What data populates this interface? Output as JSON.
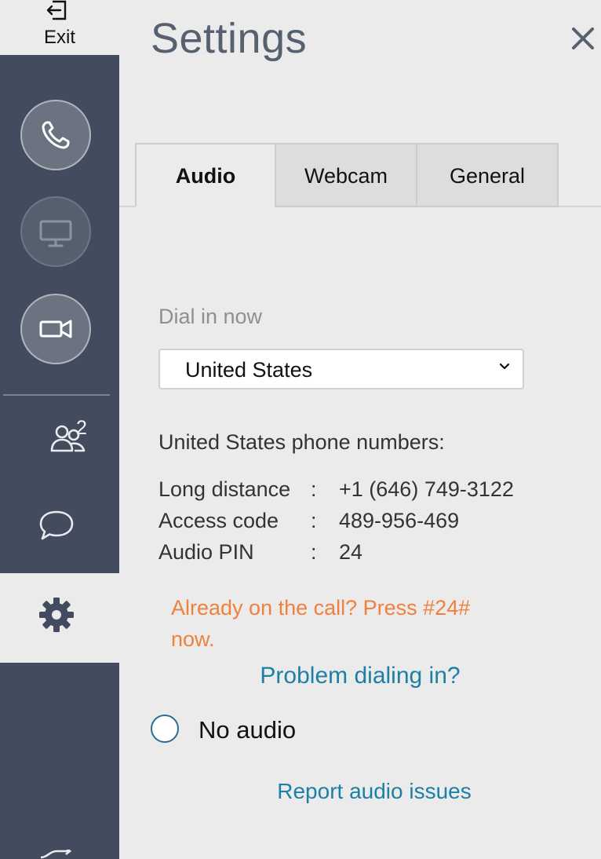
{
  "sidebar": {
    "exit_label": "Exit",
    "participant_count": "2",
    "buttons": [
      {
        "name": "phone",
        "state": "on"
      },
      {
        "name": "screen-share",
        "state": "off"
      },
      {
        "name": "video",
        "state": "on"
      }
    ],
    "icons": [
      "exit-icon",
      "phone-icon",
      "monitor-icon",
      "video-camera-icon",
      "people-icon",
      "chat-bubble-icon",
      "gear-icon",
      "shuffle-icon"
    ]
  },
  "header": {
    "title": "Settings",
    "close_icon": "close-icon"
  },
  "tabs": [
    {
      "label": "Audio",
      "active": true
    },
    {
      "label": "Webcam",
      "active": false
    },
    {
      "label": "General",
      "active": false
    }
  ],
  "audio": {
    "dial_label": "Dial in now",
    "country_select": {
      "value": "United States"
    },
    "phones_heading": "United States phone numbers:",
    "numbers": [
      {
        "label": "Long distance",
        "sep": ":",
        "value": "+1 (646) 749-3122"
      },
      {
        "label": "Access code",
        "sep": ":",
        "value": "489-956-469"
      },
      {
        "label": "Audio PIN",
        "sep": ":",
        "value": "24"
      }
    ],
    "already_on_call": "Already on the call? Press #24# now.",
    "problem_link": "Problem dialing in?",
    "no_audio_label": "No audio",
    "no_audio_selected": false,
    "report_link": "Report audio issues"
  },
  "colors": {
    "sidebar_bg": "#434c5e",
    "page_bg": "#ebebeb",
    "title": "#56606f",
    "warning": "#f0803c",
    "link": "#1d7fa6"
  }
}
